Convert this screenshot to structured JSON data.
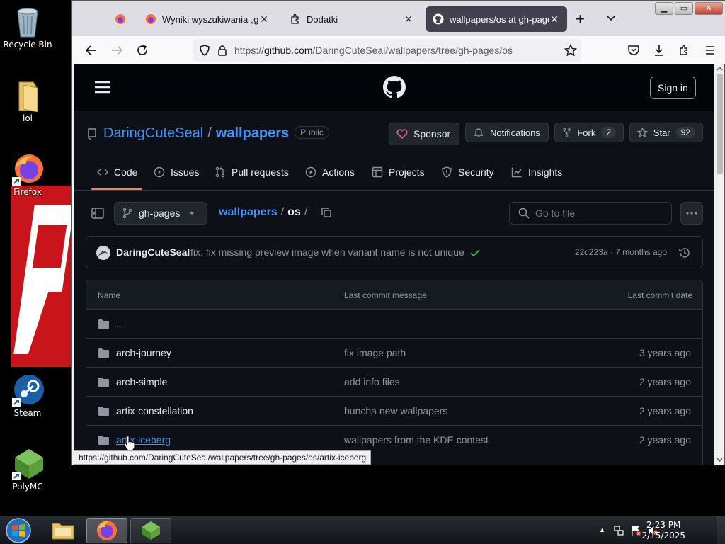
{
  "desktop": {
    "icons": [
      {
        "label": "Recycle Bin"
      },
      {
        "label": "lol"
      },
      {
        "label": "Firefox"
      },
      {
        "label": "Steam"
      },
      {
        "label": "PolyMC"
      }
    ]
  },
  "browser": {
    "tabs": [
      {
        "label": ""
      },
      {
        "label": "Wyniki wyszukiwania „glass"
      },
      {
        "label": "Dodatki"
      },
      {
        "label": "wallpapers/os at gh-pages"
      }
    ],
    "url_prefix": "https://",
    "url_host": "github.com",
    "url_path": "/DaringCuteSeal/wallpapers/tree/gh-pages/os",
    "status_url": "https://github.com/DaringCuteSeal/wallpapers/tree/gh-pages/os/artix-iceberg"
  },
  "github": {
    "signin": "Sign in",
    "owner": "DaringCuteSeal",
    "sep": "/",
    "repo": "wallpapers",
    "visibility": "Public",
    "sponsor": "Sponsor",
    "notifications": "Notifications",
    "fork": "Fork",
    "fork_count": "2",
    "star": "Star",
    "star_count": "92",
    "nav": {
      "code": "Code",
      "issues": "Issues",
      "pulls": "Pull requests",
      "actions": "Actions",
      "projects": "Projects",
      "security": "Security",
      "insights": "Insights"
    },
    "branch": "gh-pages",
    "path_repo": "wallpapers",
    "path_sep1": "/",
    "path_dir": "os",
    "path_sep2": "/",
    "search_placeholder": "Go to file",
    "commit": {
      "author": "DaringCuteSeal",
      "message": "fix: fix missing preview image when variant name is not unique",
      "hash_time": "22d223a · 7 months ago"
    },
    "table": {
      "col_name": "Name",
      "col_msg": "Last commit message",
      "col_date": "Last commit date",
      "rows": [
        {
          "name": "..",
          "msg": "",
          "date": ""
        },
        {
          "name": "arch-journey",
          "msg": "fix image path",
          "date": "3 years ago"
        },
        {
          "name": "arch-simple",
          "msg": "add info files",
          "date": "2 years ago"
        },
        {
          "name": "artix-constellation",
          "msg": "buncha new wallpapers",
          "date": "2 years ago"
        },
        {
          "name": "artix-iceberg",
          "msg": "wallpapers from the KDE contest",
          "date": "2 years ago"
        }
      ]
    }
  },
  "taskbar": {
    "time": "2:23 PM",
    "date": "2/15/2025"
  },
  "colors": {
    "gh_bg": "#0d1117",
    "gh_link": "#4493f8",
    "sponsor_heart": "#db61a2",
    "active_tab_underline": "#f78166"
  }
}
